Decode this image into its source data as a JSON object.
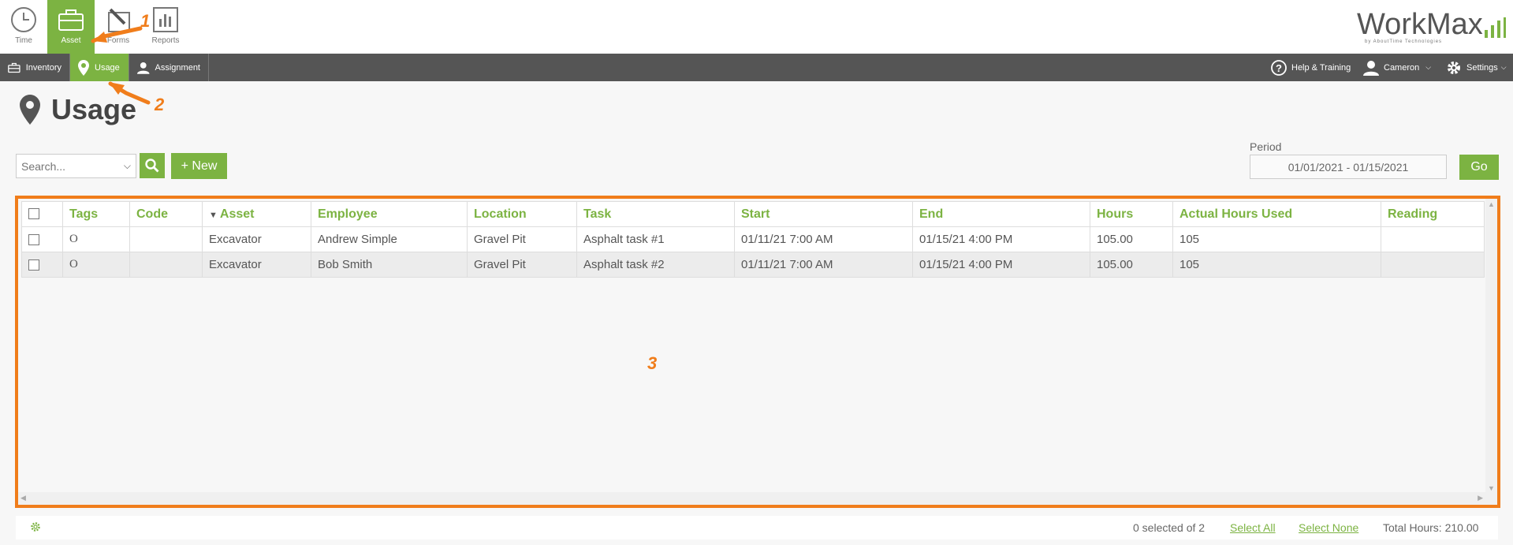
{
  "apps": [
    {
      "label": "Time",
      "icon": "clock-icon"
    },
    {
      "label": "Asset",
      "icon": "briefcase-icon"
    },
    {
      "label": "Forms",
      "icon": "pencil-icon"
    },
    {
      "label": "Reports",
      "icon": "bar-chart-icon"
    }
  ],
  "logo": {
    "text": "WorkMax",
    "sub": "by AboutTime Technologies"
  },
  "subnav": {
    "items": [
      {
        "label": "Inventory",
        "icon": "briefcase-icon"
      },
      {
        "label": "Usage",
        "icon": "map-pin-icon",
        "active": true
      },
      {
        "label": "Assignment",
        "icon": "user-icon"
      }
    ],
    "help": "Help & Training",
    "user": "Cameron",
    "settings": "Settings"
  },
  "page": {
    "title": "Usage",
    "icon": "map-pin-icon"
  },
  "toolbar": {
    "search_placeholder": "Search...",
    "new_label": "+ New",
    "period_label": "Period",
    "period_value": "01/01/2021 - 01/15/2021",
    "go_label": "Go"
  },
  "grid": {
    "columns": [
      "Tags",
      "Code",
      "Asset",
      "Employee",
      "Location",
      "Task",
      "Start",
      "End",
      "Hours",
      "Actual Hours Used",
      "Reading"
    ],
    "rows": [
      {
        "tag": "O",
        "code": "",
        "asset": "Excavator",
        "employee": "Andrew Simple",
        "location": "Gravel Pit",
        "task": "Asphalt task #1",
        "start": "01/11/21 7:00 AM",
        "end": "01/15/21 4:00 PM",
        "hours": "105.00",
        "actual": "105",
        "reading": ""
      },
      {
        "tag": "O",
        "code": "",
        "asset": "Excavator",
        "employee": "Bob Smith",
        "location": "Gravel Pit",
        "task": "Asphalt task #2",
        "start": "01/11/21 7:00 AM",
        "end": "01/15/21 4:00 PM",
        "hours": "105.00",
        "actual": "105",
        "reading": ""
      }
    ]
  },
  "footer": {
    "selected": "0 selected of 2",
    "select_all": "Select All",
    "select_none": "Select None",
    "total_hours": "Total Hours: 210.00"
  },
  "callouts": [
    "1",
    "2",
    "3"
  ],
  "colors": {
    "accent": "#7cb342",
    "annotation": "#f07d1b",
    "navbar": "#555555"
  }
}
